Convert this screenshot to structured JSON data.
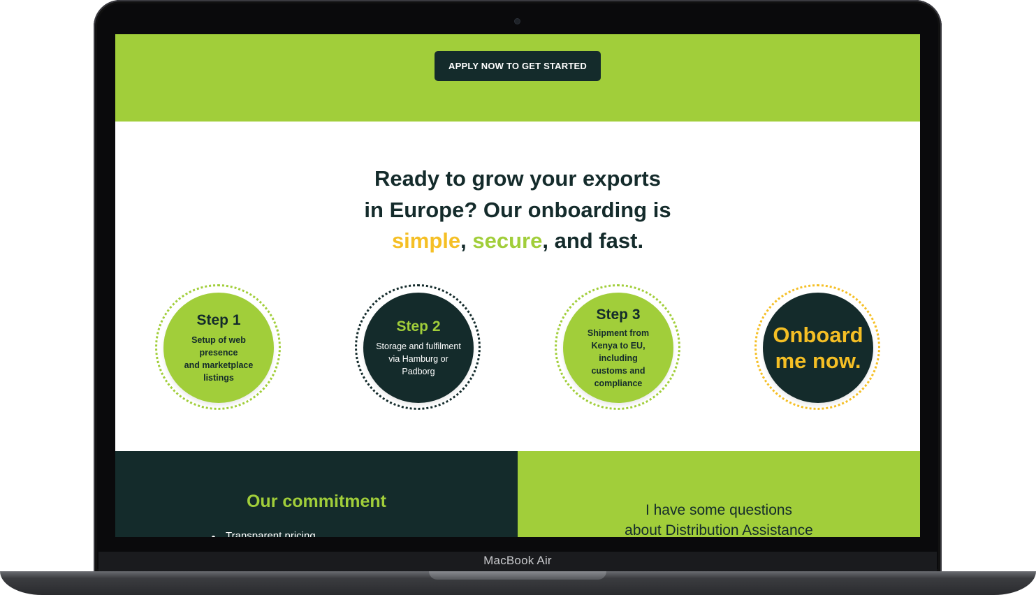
{
  "device": {
    "brand_label": "MacBook Air"
  },
  "hero": {
    "cta_label": "APPLY NOW TO GET STARTED"
  },
  "onboarding": {
    "headline_line1": "Ready to grow your exports",
    "headline_line2": "in Europe? Our onboarding is",
    "word_simple": "simple",
    "sep1": ", ",
    "word_secure": "secure",
    "tail": ", and fast."
  },
  "steps": [
    {
      "title": "Step 1",
      "desc_lines": [
        "Setup of web",
        "presence",
        "and marketplace",
        "listings"
      ]
    },
    {
      "title": "Step 2",
      "desc_lines": [
        "Storage and fulfilment",
        "via Hamburg or",
        "Padborg"
      ]
    },
    {
      "title": "Step 3",
      "desc_lines": [
        "Shipment from",
        "Kenya to EU,",
        "including",
        "customs and",
        "compliance"
      ]
    }
  ],
  "onboard_cta": {
    "line1": "Onboard",
    "line2": "me now."
  },
  "commitment": {
    "title": "Our commitment",
    "items": [
      "Transparent pricing"
    ]
  },
  "questions": {
    "line1": "I have some questions",
    "line2": "about Distribution Assistance"
  },
  "colors": {
    "green": "#a1ce3a",
    "dark": "#142b2b",
    "yellow": "#f5bf25"
  }
}
